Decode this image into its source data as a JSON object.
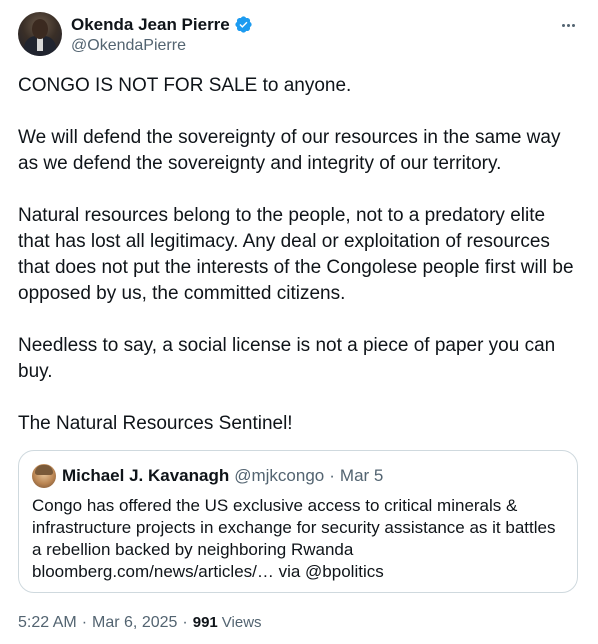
{
  "author": {
    "name": "Okenda Jean Pierre",
    "handle": "@OkendaPierre",
    "verified": true
  },
  "tweet": {
    "paragraphs": [
      "CONGO IS NOT FOR SALE to anyone.",
      "We will defend the sovereignty of our resources in the same way as we defend the sovereignty and integrity of our territory.",
      "Natural resources belong to the people, not to a predatory elite that has lost all legitimacy. Any deal or exploitation of resources that does not put the interests of the Congolese people first will be opposed by us, the committed citizens.",
      "Needless to say, a social license is not a piece of paper you can buy.",
      "The Natural Resources Sentinel!"
    ]
  },
  "quote": {
    "name": "Michael J. Kavanagh",
    "handle": "@mjkcongo",
    "separator": "·",
    "date": "Mar 5",
    "text": "Congo has offered the US exclusive access to critical minerals & infrastructure projects in exchange for security assistance as it battles a rebellion backed by neighboring Rwanda bloomberg.com/news/articles/… via @bpolitics"
  },
  "meta": {
    "time": "5:22 AM",
    "separator": "·",
    "date": "Mar 6, 2025",
    "views_count": "991",
    "views_label": "Views"
  },
  "colors": {
    "accent": "#1d9bf0",
    "text": "#0f1419",
    "secondary": "#536471",
    "border": "#cfd9de"
  },
  "icons": {
    "verified": "verified-badge-icon",
    "more": "more-options-icon"
  }
}
